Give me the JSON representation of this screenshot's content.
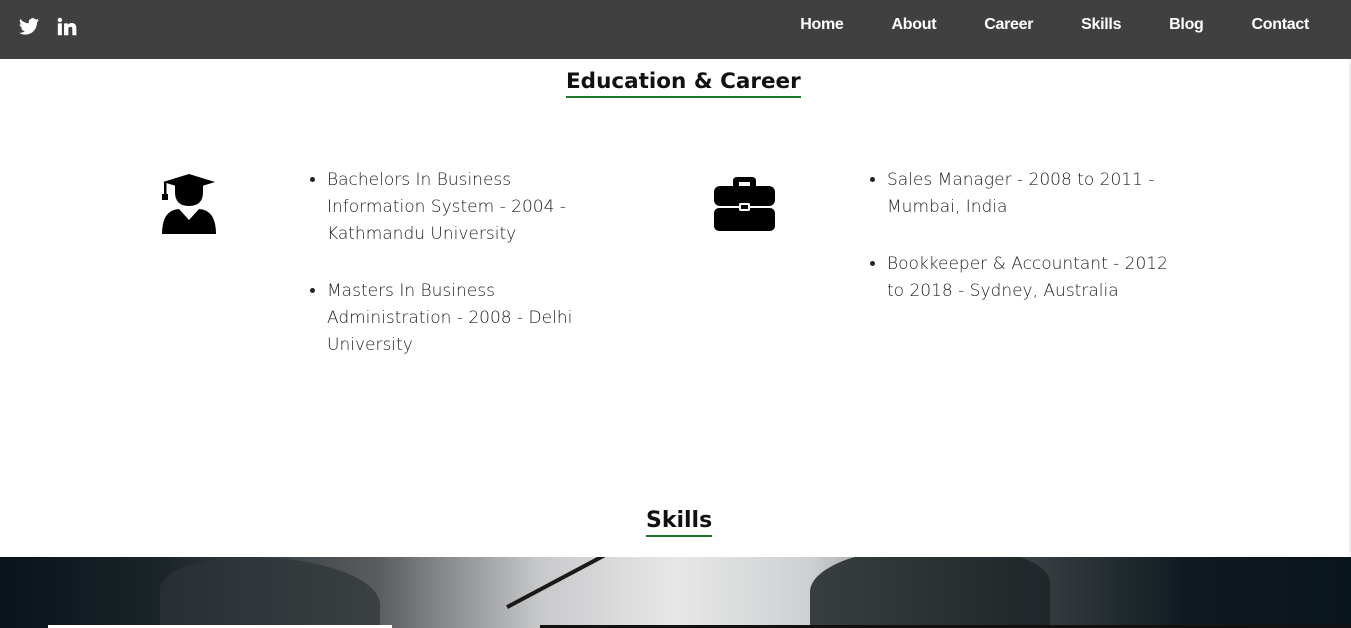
{
  "nav": {
    "social": [
      {
        "icon": "twitter-icon"
      },
      {
        "icon": "linkedin-icon"
      }
    ],
    "links": [
      "Home",
      "About",
      "Career",
      "Skills",
      "Blog",
      "Contact"
    ]
  },
  "education_career": {
    "title": "Education & Career",
    "education_icon": "graduate-icon",
    "career_icon": "briefcase-icon",
    "education": [
      "Bachelors In Business Information System - 2004 - Kathmandu University",
      "Masters In Business Administration - 2008 - Delhi University"
    ],
    "career": [
      "Sales Manager - 2008 to 2011 - Mumbai, India",
      "Bookkeeper & Accountant - 2012 to 2018 - Sydney, Australia"
    ]
  },
  "skills": {
    "title": "Skills"
  },
  "colors": {
    "navbar": "#404040",
    "accent_underline": "#1a7a2a"
  }
}
